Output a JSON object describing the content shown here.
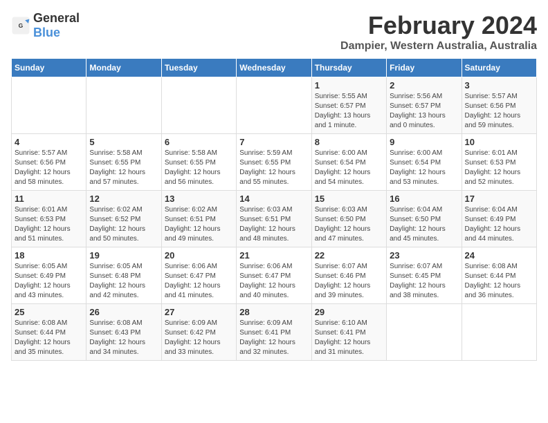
{
  "logo": {
    "general": "General",
    "blue": "Blue"
  },
  "title": "February 2024",
  "subtitle": "Dampier, Western Australia, Australia",
  "days_of_week": [
    "Sunday",
    "Monday",
    "Tuesday",
    "Wednesday",
    "Thursday",
    "Friday",
    "Saturday"
  ],
  "weeks": [
    [
      {
        "day": "",
        "info": ""
      },
      {
        "day": "",
        "info": ""
      },
      {
        "day": "",
        "info": ""
      },
      {
        "day": "",
        "info": ""
      },
      {
        "day": "1",
        "info": "Sunrise: 5:55 AM\nSunset: 6:57 PM\nDaylight: 13 hours and 1 minute."
      },
      {
        "day": "2",
        "info": "Sunrise: 5:56 AM\nSunset: 6:57 PM\nDaylight: 13 hours and 0 minutes."
      },
      {
        "day": "3",
        "info": "Sunrise: 5:57 AM\nSunset: 6:56 PM\nDaylight: 12 hours and 59 minutes."
      }
    ],
    [
      {
        "day": "4",
        "info": "Sunrise: 5:57 AM\nSunset: 6:56 PM\nDaylight: 12 hours and 58 minutes."
      },
      {
        "day": "5",
        "info": "Sunrise: 5:58 AM\nSunset: 6:55 PM\nDaylight: 12 hours and 57 minutes."
      },
      {
        "day": "6",
        "info": "Sunrise: 5:58 AM\nSunset: 6:55 PM\nDaylight: 12 hours and 56 minutes."
      },
      {
        "day": "7",
        "info": "Sunrise: 5:59 AM\nSunset: 6:55 PM\nDaylight: 12 hours and 55 minutes."
      },
      {
        "day": "8",
        "info": "Sunrise: 6:00 AM\nSunset: 6:54 PM\nDaylight: 12 hours and 54 minutes."
      },
      {
        "day": "9",
        "info": "Sunrise: 6:00 AM\nSunset: 6:54 PM\nDaylight: 12 hours and 53 minutes."
      },
      {
        "day": "10",
        "info": "Sunrise: 6:01 AM\nSunset: 6:53 PM\nDaylight: 12 hours and 52 minutes."
      }
    ],
    [
      {
        "day": "11",
        "info": "Sunrise: 6:01 AM\nSunset: 6:53 PM\nDaylight: 12 hours and 51 minutes."
      },
      {
        "day": "12",
        "info": "Sunrise: 6:02 AM\nSunset: 6:52 PM\nDaylight: 12 hours and 50 minutes."
      },
      {
        "day": "13",
        "info": "Sunrise: 6:02 AM\nSunset: 6:51 PM\nDaylight: 12 hours and 49 minutes."
      },
      {
        "day": "14",
        "info": "Sunrise: 6:03 AM\nSunset: 6:51 PM\nDaylight: 12 hours and 48 minutes."
      },
      {
        "day": "15",
        "info": "Sunrise: 6:03 AM\nSunset: 6:50 PM\nDaylight: 12 hours and 47 minutes."
      },
      {
        "day": "16",
        "info": "Sunrise: 6:04 AM\nSunset: 6:50 PM\nDaylight: 12 hours and 45 minutes."
      },
      {
        "day": "17",
        "info": "Sunrise: 6:04 AM\nSunset: 6:49 PM\nDaylight: 12 hours and 44 minutes."
      }
    ],
    [
      {
        "day": "18",
        "info": "Sunrise: 6:05 AM\nSunset: 6:49 PM\nDaylight: 12 hours and 43 minutes."
      },
      {
        "day": "19",
        "info": "Sunrise: 6:05 AM\nSunset: 6:48 PM\nDaylight: 12 hours and 42 minutes."
      },
      {
        "day": "20",
        "info": "Sunrise: 6:06 AM\nSunset: 6:47 PM\nDaylight: 12 hours and 41 minutes."
      },
      {
        "day": "21",
        "info": "Sunrise: 6:06 AM\nSunset: 6:47 PM\nDaylight: 12 hours and 40 minutes."
      },
      {
        "day": "22",
        "info": "Sunrise: 6:07 AM\nSunset: 6:46 PM\nDaylight: 12 hours and 39 minutes."
      },
      {
        "day": "23",
        "info": "Sunrise: 6:07 AM\nSunset: 6:45 PM\nDaylight: 12 hours and 38 minutes."
      },
      {
        "day": "24",
        "info": "Sunrise: 6:08 AM\nSunset: 6:44 PM\nDaylight: 12 hours and 36 minutes."
      }
    ],
    [
      {
        "day": "25",
        "info": "Sunrise: 6:08 AM\nSunset: 6:44 PM\nDaylight: 12 hours and 35 minutes."
      },
      {
        "day": "26",
        "info": "Sunrise: 6:08 AM\nSunset: 6:43 PM\nDaylight: 12 hours and 34 minutes."
      },
      {
        "day": "27",
        "info": "Sunrise: 6:09 AM\nSunset: 6:42 PM\nDaylight: 12 hours and 33 minutes."
      },
      {
        "day": "28",
        "info": "Sunrise: 6:09 AM\nSunset: 6:41 PM\nDaylight: 12 hours and 32 minutes."
      },
      {
        "day": "29",
        "info": "Sunrise: 6:10 AM\nSunset: 6:41 PM\nDaylight: 12 hours and 31 minutes."
      },
      {
        "day": "",
        "info": ""
      },
      {
        "day": "",
        "info": ""
      }
    ]
  ]
}
